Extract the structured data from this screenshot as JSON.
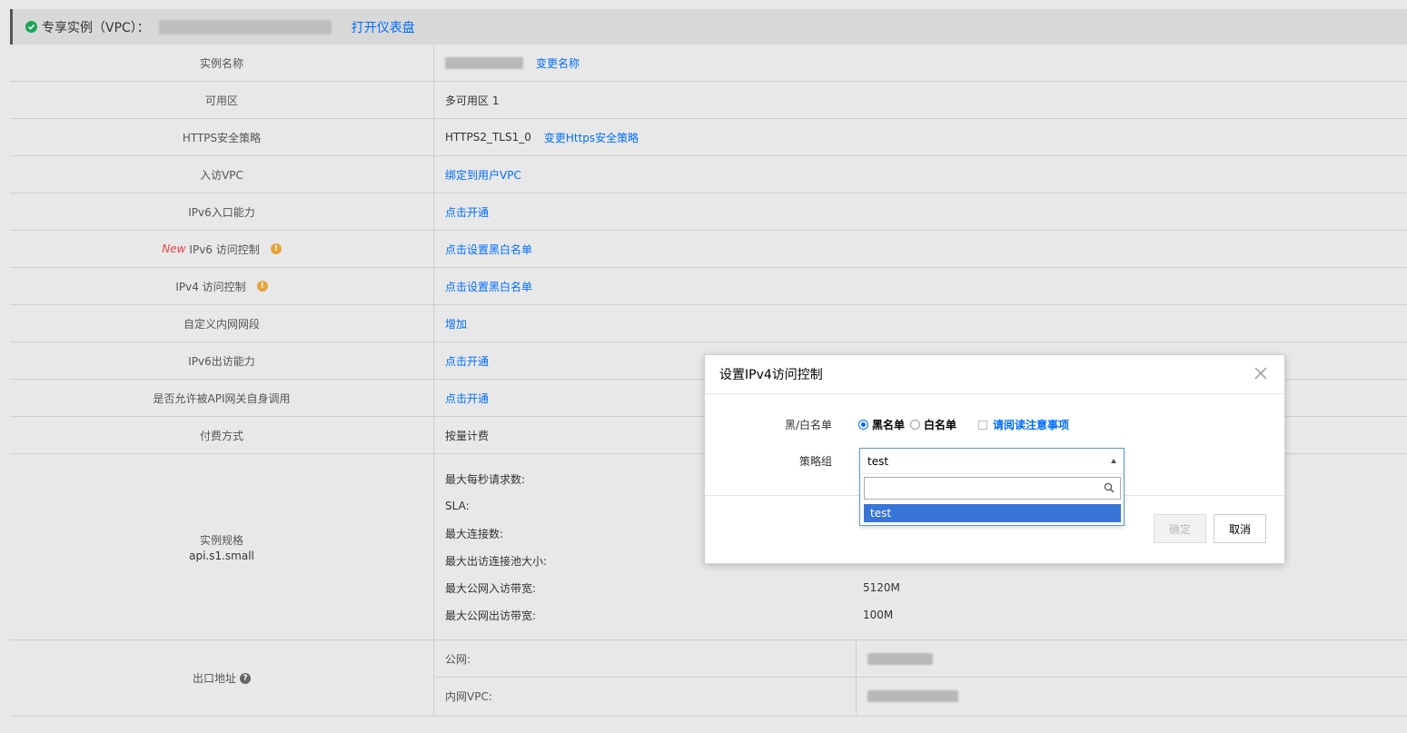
{
  "header": {
    "title": "专享实例（VPC）：",
    "dashboard_link": "打开仪表盘"
  },
  "rows": [
    {
      "label": "实例名称",
      "link": "变更名称"
    },
    {
      "label": "可用区",
      "value": "多可用区 1"
    },
    {
      "label": "HTTPS安全策略",
      "value": "HTTPS2_TLS1_0",
      "link": "变更Https安全策略"
    },
    {
      "label": "入访VPC",
      "link": "绑定到用户VPC"
    },
    {
      "label": "IPv6入口能力",
      "link": "点击开通"
    },
    {
      "label": "IPv6 访问控制",
      "badge": "New",
      "link": "点击设置黑白名单"
    },
    {
      "label": "IPv4 访问控制",
      "link": "点击设置黑白名单"
    },
    {
      "label": "自定义内网网段",
      "link": "增加"
    },
    {
      "label": "IPv6出访能力",
      "link": "点击开通"
    },
    {
      "label": "是否允许被API网关自身调用",
      "link": "点击开通"
    },
    {
      "label": "付费方式",
      "value": "按量计费"
    }
  ],
  "spec": {
    "label": "实例规格",
    "sub": "api.s1.small",
    "items": [
      {
        "k": "最大每秒请求数:",
        "v": ""
      },
      {
        "k": "SLA:",
        "v": ""
      },
      {
        "k": "最大连接数:",
        "v": ""
      },
      {
        "k": "最大出访连接池大小:",
        "v": ""
      },
      {
        "k": "最大公网入访带宽:",
        "v": "5120M"
      },
      {
        "k": "最大公网出访带宽:",
        "v": "100M"
      }
    ]
  },
  "exit": {
    "label": "出口地址",
    "public_label": "公网:",
    "vpc_label": "内网VPC:"
  },
  "modal": {
    "title": "设置IPv4访问控制",
    "list_label": "黑/白名单",
    "blacklist": "黑名单",
    "whitelist": "白名单",
    "notice": "请阅读注意事项",
    "policy_label": "策略组",
    "ok": "确定",
    "cancel": "取消"
  },
  "dropdown": {
    "selected": "test",
    "search_placeholder": "",
    "options": [
      "test"
    ]
  },
  "colors": {
    "link": "#006eff",
    "success": "#18a558",
    "warning": "#e6a23c",
    "new_badge": "#e54545",
    "selected_option": "#3875d7"
  }
}
